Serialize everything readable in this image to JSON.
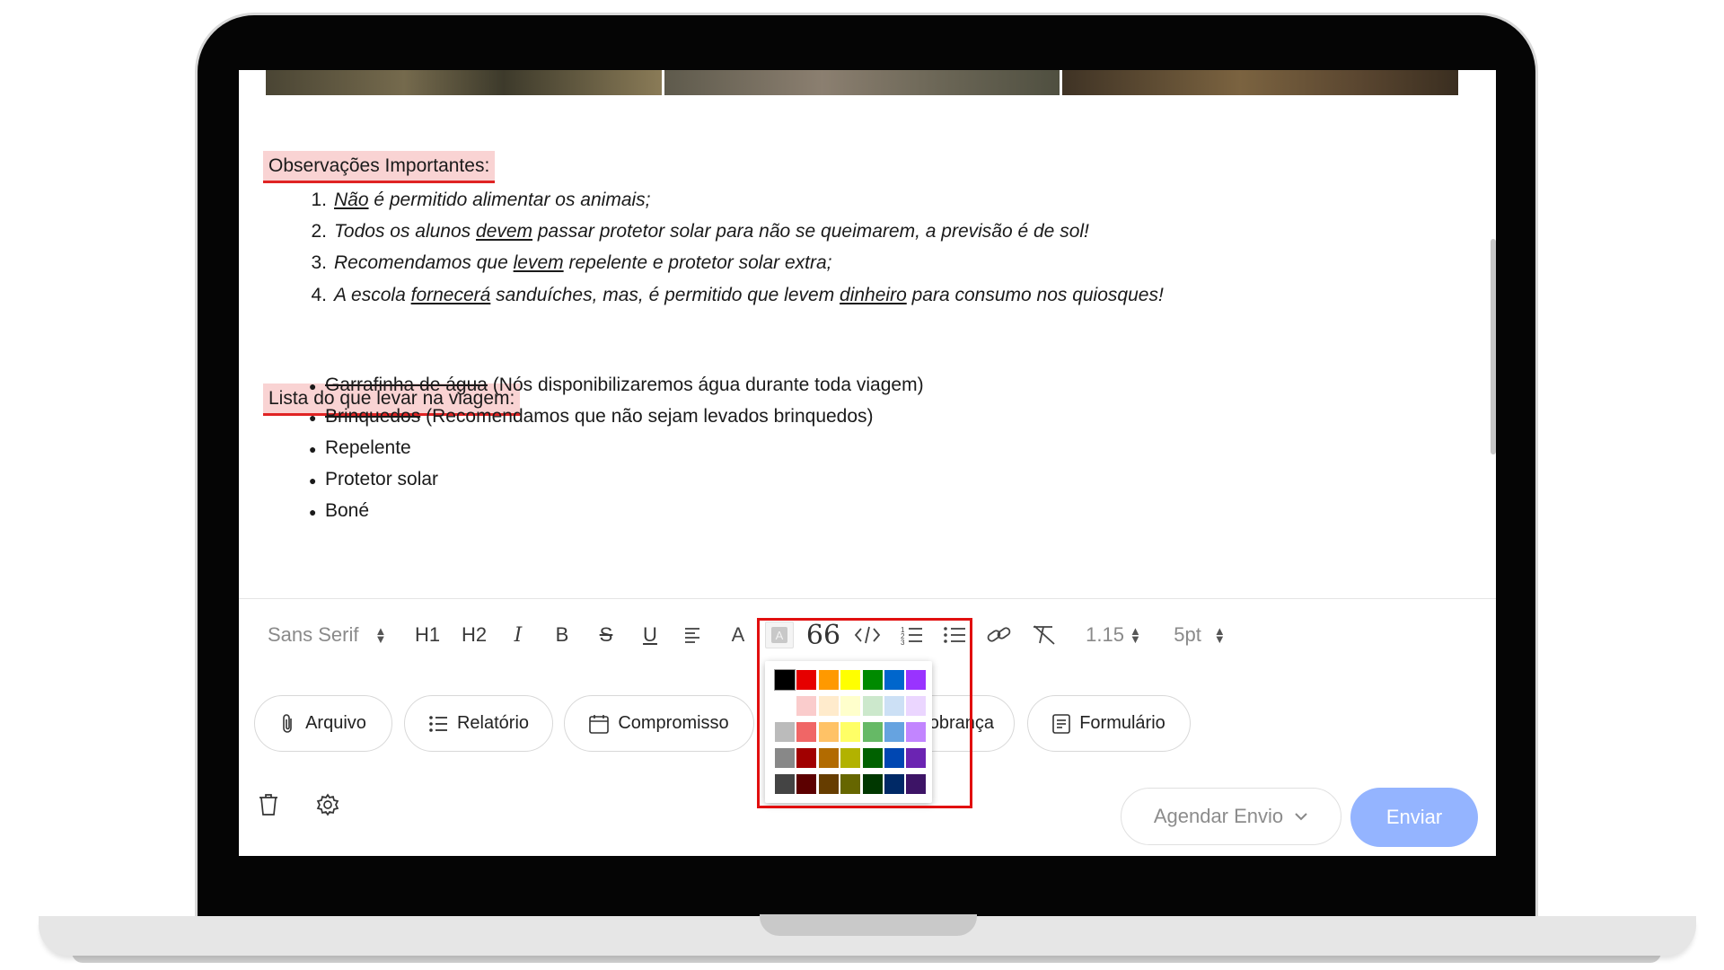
{
  "editor": {
    "heading_observations": "Observações Importantes:",
    "observations": [
      {
        "num": "1.",
        "parts": [
          {
            "text": "Não",
            "u": true
          },
          {
            "text": " é permitido alimentar os animais;",
            "u": false
          }
        ]
      },
      {
        "num": "2.",
        "parts": [
          {
            "text": "Todos os alunos ",
            "u": false
          },
          {
            "text": "devem",
            "u": true
          },
          {
            "text": " passar protetor solar para não se queimarem, a previsão é de sol!",
            "u": false
          }
        ]
      },
      {
        "num": "3.",
        "parts": [
          {
            "text": "Recomendamos que ",
            "u": false
          },
          {
            "text": "levem",
            "u": true
          },
          {
            "text": " repelente e protetor solar extra;",
            "u": false
          }
        ]
      },
      {
        "num": "4.",
        "parts": [
          {
            "text": "A escola ",
            "u": false
          },
          {
            "text": "fornecerá",
            "u": true
          },
          {
            "text": " sanduíches, mas, é permitido que levem ",
            "u": false
          },
          {
            "text": "dinheiro",
            "u": true
          },
          {
            "text": " para consumo nos quiosques!",
            "u": false
          }
        ]
      }
    ],
    "heading_list": "Lista do que levar na viagem:",
    "packing_list": [
      {
        "struck": "Garrafinha de água",
        "rest": " (Nós disponibilizaremos água durante toda viagem)"
      },
      {
        "struck": "Brinquedos",
        "rest": " (Recomendamos que não sejam levados brinquedos)"
      },
      {
        "struck": "",
        "rest": "Repelente"
      },
      {
        "struck": "",
        "rest": "Protetor solar"
      },
      {
        "struck": "",
        "rest": "Boné"
      }
    ],
    "bullet": "●"
  },
  "toolbar": {
    "font": "Sans Serif",
    "h1": "H1",
    "h2": "H2",
    "italic": "I",
    "bold": "B",
    "strike": "S",
    "underline": "U",
    "font_color": "A",
    "line_height": "1.15",
    "padding": "5pt",
    "icons": [
      "align-left-icon",
      "text-color-icon",
      "highlight-icon",
      "quote-icon",
      "code-icon",
      "ordered-list-icon",
      "bullet-list-icon",
      "link-icon",
      "clear-format-icon"
    ]
  },
  "color_picker": {
    "columns": 7,
    "colors": [
      "#000000",
      "#e60000",
      "#ff9900",
      "#ffff00",
      "#008a00",
      "#0066cc",
      "#9933ff",
      "#ffffff",
      "#facccc",
      "#ffebcc",
      "#ffffcc",
      "#cce8cc",
      "#cce0f5",
      "#ebd6ff",
      "#bbbbbb",
      "#f06666",
      "#ffc266",
      "#ffff66",
      "#66b966",
      "#66a3e0",
      "#c285ff",
      "#888888",
      "#a10000",
      "#b26b00",
      "#b2b200",
      "#006100",
      "#0047b2",
      "#6b24b2",
      "#444444",
      "#5c0000",
      "#663d00",
      "#666600",
      "#003700",
      "#002966",
      "#3d1466"
    ],
    "selected_index": 0
  },
  "actions": {
    "file": "Arquivo",
    "report": "Relatório",
    "appointment": "Compromisso",
    "billing": "Cobrança",
    "form": "Formulário"
  },
  "footer": {
    "schedule": "Agendar Envio",
    "send": "Enviar"
  },
  "colors": {
    "heading_highlight": "#f9d3d3",
    "heading_underline": "#e02424",
    "send_button": "#94b4ff",
    "callout_frame": "#e10f0f"
  }
}
